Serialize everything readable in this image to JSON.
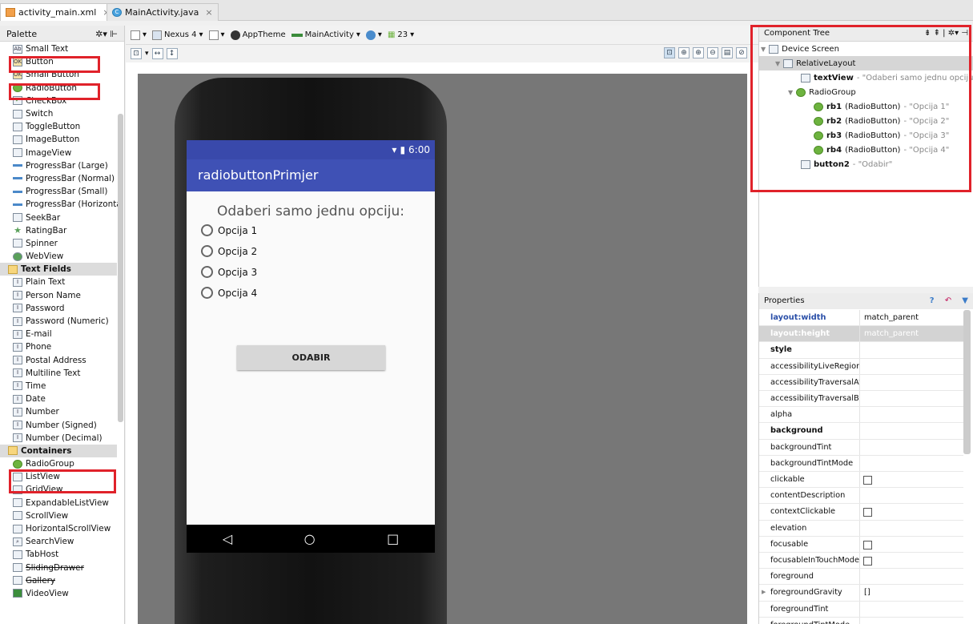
{
  "tabs": [
    {
      "label": "activity_main.xml",
      "close": "×"
    },
    {
      "label": "MainActivity.java",
      "close": "×"
    }
  ],
  "palette": {
    "title": "Palette",
    "items": [
      {
        "label": "Small Text",
        "icon": "Ab"
      },
      {
        "label": "Button",
        "icon": "OK"
      },
      {
        "label": "Small Button",
        "icon": "OK"
      },
      {
        "label": "RadioButton",
        "icon": "radio"
      },
      {
        "label": "CheckBox",
        "icon": "check"
      },
      {
        "label": "Switch",
        "icon": "sw"
      },
      {
        "label": "ToggleButton",
        "icon": "tg"
      },
      {
        "label": "ImageButton",
        "icon": "img"
      },
      {
        "label": "ImageView",
        "icon": "img"
      },
      {
        "label": "ProgressBar (Large)",
        "icon": "dash"
      },
      {
        "label": "ProgressBar (Normal)",
        "icon": "dash"
      },
      {
        "label": "ProgressBar (Small)",
        "icon": "dash"
      },
      {
        "label": "ProgressBar (Horizontal)",
        "icon": "dash"
      },
      {
        "label": "SeekBar",
        "icon": "seek"
      },
      {
        "label": "RatingBar",
        "icon": "star"
      },
      {
        "label": "Spinner",
        "icon": "sp"
      },
      {
        "label": "WebView",
        "icon": "web"
      },
      {
        "label": "Text Fields",
        "icon": "folder",
        "cat": true
      },
      {
        "label": "Plain Text",
        "icon": "I"
      },
      {
        "label": "Person Name",
        "icon": "I"
      },
      {
        "label": "Password",
        "icon": "I"
      },
      {
        "label": "Password (Numeric)",
        "icon": "I"
      },
      {
        "label": "E-mail",
        "icon": "I"
      },
      {
        "label": "Phone",
        "icon": "I"
      },
      {
        "label": "Postal Address",
        "icon": "I"
      },
      {
        "label": "Multiline Text",
        "icon": "I"
      },
      {
        "label": "Time",
        "icon": "I"
      },
      {
        "label": "Date",
        "icon": "I"
      },
      {
        "label": "Number",
        "icon": "I"
      },
      {
        "label": "Number (Signed)",
        "icon": "I"
      },
      {
        "label": "Number (Decimal)",
        "icon": "I"
      },
      {
        "label": "Containers",
        "icon": "folder",
        "cat": true
      },
      {
        "label": "RadioGroup",
        "icon": "rg"
      },
      {
        "label": "ListView",
        "icon": "lv"
      },
      {
        "label": "GridView",
        "icon": "gv"
      },
      {
        "label": "ExpandableListView",
        "icon": "el"
      },
      {
        "label": "ScrollView",
        "icon": "sv"
      },
      {
        "label": "HorizontalScrollView",
        "icon": "hs"
      },
      {
        "label": "SearchView",
        "icon": "search"
      },
      {
        "label": "TabHost",
        "icon": "th"
      },
      {
        "label": "SlidingDrawer",
        "icon": "sd",
        "strike": true
      },
      {
        "label": "Gallery",
        "icon": "gal",
        "strike": true
      },
      {
        "label": "VideoView",
        "icon": "vid"
      }
    ]
  },
  "toolbar": {
    "device": "Nexus 4",
    "theme": "AppTheme",
    "activity": "MainActivity",
    "api": "23"
  },
  "phone": {
    "time": "6:00",
    "app_title": "radiobuttonPrimjer",
    "question": "Odaberi samo jednu opciju:",
    "options": [
      "Opcija 1",
      "Opcija 2",
      "Opcija 3",
      "Opcija 4"
    ],
    "button": "ODABIR",
    "nav": [
      "◁",
      "○",
      "□"
    ]
  },
  "component_tree": {
    "title": "Component Tree",
    "rows": [
      {
        "name": "Device Screen",
        "hint": "",
        "bold": false
      },
      {
        "name": "RelativeLayout",
        "hint": "",
        "bold": false
      },
      {
        "name": "textView",
        "hint": " - \"Odaberi samo jednu opciju:\"",
        "bold": true
      },
      {
        "name": "RadioGroup",
        "hint": "",
        "bold": false
      },
      {
        "name": "rb1",
        "type": " (RadioButton)",
        "hint": " - \"Opcija 1\"",
        "bold": true
      },
      {
        "name": "rb2",
        "type": " (RadioButton)",
        "hint": " - \"Opcija 2\"",
        "bold": true
      },
      {
        "name": "rb3",
        "type": " (RadioButton)",
        "hint": " - \"Opcija 3\"",
        "bold": true
      },
      {
        "name": "rb4",
        "type": " (RadioButton)",
        "hint": " - \"Opcija 4\"",
        "bold": true
      },
      {
        "name": "button2",
        "hint": " - \"Odabir\"",
        "bold": true
      }
    ]
  },
  "properties": {
    "title": "Properties",
    "rows": [
      {
        "name": "layout:width",
        "value": "match_parent"
      },
      {
        "name": "layout:height",
        "value": "match_parent"
      },
      {
        "name": "style",
        "value": ""
      },
      {
        "name": "accessibilityLiveRegion",
        "value": ""
      },
      {
        "name": "accessibilityTraversalAfte",
        "value": ""
      },
      {
        "name": "accessibilityTraversalBefc",
        "value": ""
      },
      {
        "name": "alpha",
        "value": ""
      },
      {
        "name": "background",
        "value": ""
      },
      {
        "name": "backgroundTint",
        "value": ""
      },
      {
        "name": "backgroundTintMode",
        "value": ""
      },
      {
        "name": "clickable",
        "value": ""
      },
      {
        "name": "contentDescription",
        "value": ""
      },
      {
        "name": "contextClickable",
        "value": ""
      },
      {
        "name": "elevation",
        "value": ""
      },
      {
        "name": "focusable",
        "value": ""
      },
      {
        "name": "focusableInTouchMode",
        "value": ""
      },
      {
        "name": "foreground",
        "value": ""
      },
      {
        "name": "foregroundGravity",
        "value": "[]"
      },
      {
        "name": "foregroundTint",
        "value": ""
      },
      {
        "name": "foregroundTintMode",
        "value": ""
      }
    ]
  }
}
